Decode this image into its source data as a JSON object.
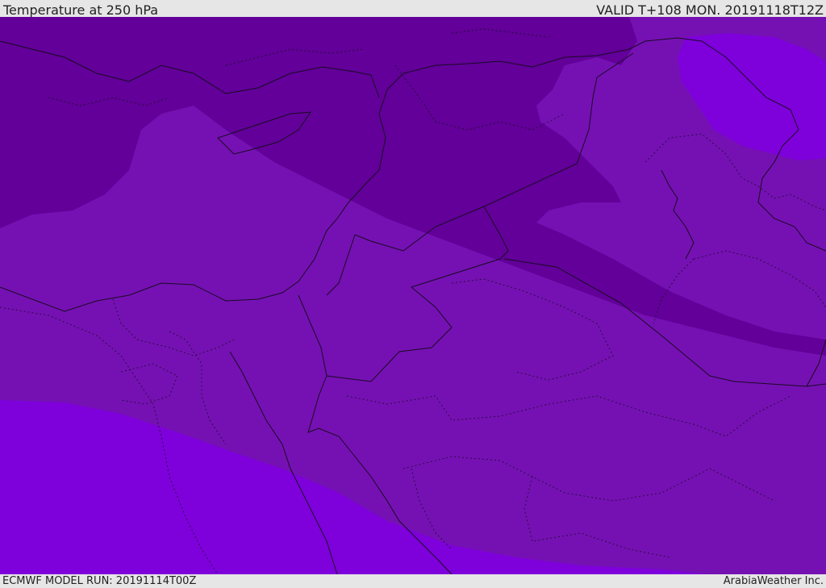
{
  "header": {
    "title": "Temperature at 250 hPa",
    "valid_time": "VALID T+108 MON. 20191118T12Z"
  },
  "footer": {
    "model_run": "ECMWF MODEL RUN: 20191114T00Z",
    "credit": "ArabiaWeather Inc."
  },
  "colors": {
    "coldest_band": "#620099",
    "mid_band": "#7511b3",
    "warm_band": "#7e00db",
    "border_line": "#1a0a22"
  }
}
